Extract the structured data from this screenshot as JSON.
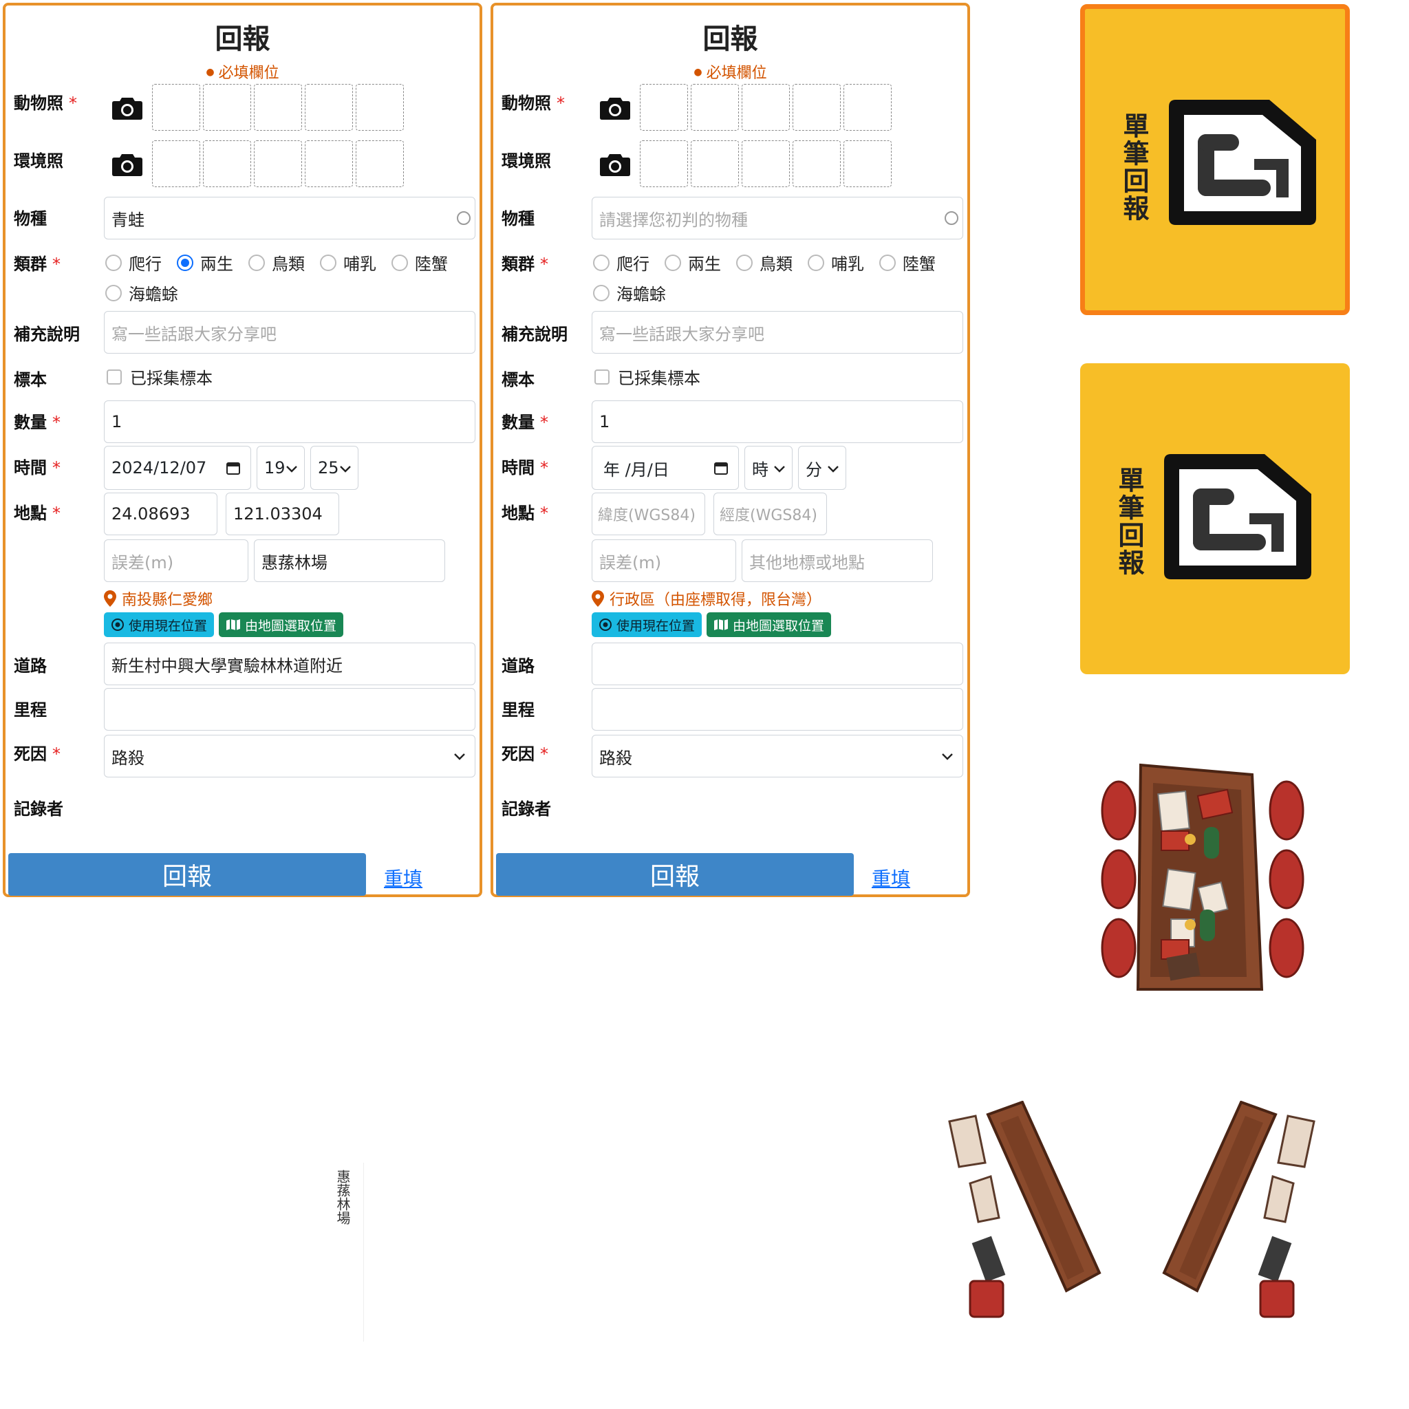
{
  "forms": [
    {
      "title": "回報",
      "required_note": "必填欄位",
      "labels": {
        "animal_photo": "動物照",
        "env_photo": "環境照",
        "species": "物種",
        "group": "類群",
        "note": "補充說明",
        "specimen": "標本",
        "count": "數量",
        "time": "時間",
        "location": "地點",
        "road": "道路",
        "mileage": "里程",
        "death_cause": "死因",
        "recorder": "記錄者"
      },
      "species_value": "青蛙",
      "groups": [
        "爬行",
        "兩生",
        "鳥類",
        "哺乳",
        "陸蟹",
        "海蟾蜍"
      ],
      "group_selected": "兩生",
      "note_placeholder": "寫一些話跟大家分享吧",
      "specimen_label": "已採集標本",
      "count_value": "1",
      "date_value": "2024/12/07",
      "hour_value": "19",
      "minute_value": "25",
      "lat_value": "24.08693",
      "lng_value": "121.03304",
      "error_placeholder": "誤差(m)",
      "place_value": "惠蓀林場",
      "district": "南投縣仁愛鄉",
      "use_current_location": "使用現在位置",
      "pick_from_map": "由地圖選取位置",
      "road_value": "新生村中興大學實驗林林道附近",
      "mileage_value": "",
      "death_cause_value": "路殺",
      "submit": "回報",
      "reset": "重填"
    },
    {
      "title": "回報",
      "required_note": "必填欄位",
      "labels": {
        "animal_photo": "動物照",
        "env_photo": "環境照",
        "species": "物種",
        "group": "類群",
        "note": "補充說明",
        "specimen": "標本",
        "count": "數量",
        "time": "時間",
        "location": "地點",
        "road": "道路",
        "mileage": "里程",
        "death_cause": "死因",
        "recorder": "記錄者"
      },
      "species_placeholder": "請選擇您初判的物種",
      "groups": [
        "爬行",
        "兩生",
        "鳥類",
        "哺乳",
        "陸蟹",
        "海蟾蜍"
      ],
      "group_selected": "",
      "note_placeholder": "寫一些話跟大家分享吧",
      "specimen_label": "已採集標本",
      "count_value": "1",
      "date_placeholder": "年 /月/日",
      "hour_placeholder": "時",
      "minute_placeholder": "分",
      "lat_placeholder": "緯度(WGS84)",
      "lng_placeholder": "經度(WGS84)",
      "error_placeholder": "誤差(m)",
      "place_placeholder": "其他地標或地點",
      "district": "行政區（由座標取得，限台灣）",
      "use_current_location": "使用現在位置",
      "pick_from_map": "由地圖選取位置",
      "road_value": "",
      "mileage_value": "",
      "death_cause_value": "路殺",
      "submit": "回報",
      "reset": "重填"
    }
  ],
  "cards": [
    {
      "label": "單筆回報",
      "state": "active"
    },
    {
      "label": "單筆回報",
      "state": "normal"
    }
  ],
  "vertical_label": "惠蓀林場",
  "colors": {
    "panel_border": "#e8922a",
    "card_bg": "#f7be27",
    "card_active_border": "#f77f17",
    "submit_bg": "#3e86c8"
  },
  "icons": [
    "camera-icon",
    "map-pin-icon",
    "crosshair-icon",
    "map-icon",
    "calendar-icon",
    "chevron-down-icon",
    "document-icon",
    "table-illustration",
    "bench-illustration"
  ]
}
